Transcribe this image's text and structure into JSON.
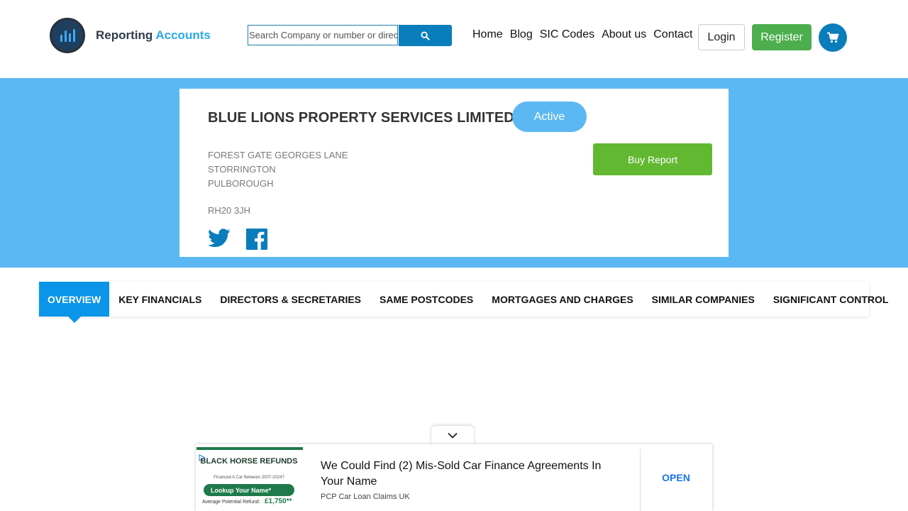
{
  "header": {
    "logo": {
      "text_primary": "Reporting",
      "text_accent": "Accounts"
    },
    "search": {
      "placeholder": "Search Company or number or director"
    },
    "nav": [
      {
        "label": "Home"
      },
      {
        "label": "Blog"
      },
      {
        "label": "SIC Codes"
      },
      {
        "label": "About us"
      },
      {
        "label": "Contact"
      }
    ],
    "login_label": "Login",
    "register_label": "Register"
  },
  "company": {
    "name": "BLUE LIONS PROPERTY SERVICES LIMITED",
    "status": "Active",
    "address_lines": [
      "FOREST GATE GEORGES LANE",
      "STORRINGTON",
      "PULBOROUGH"
    ],
    "postcode": "RH20 3JH",
    "buy_label": "Buy Report"
  },
  "tabs": [
    {
      "label": "OVERVIEW",
      "active": true
    },
    {
      "label": "KEY FINANCIALS"
    },
    {
      "label": "DIRECTORS & SECRETARIES"
    },
    {
      "label": "SAME POSTCODES"
    },
    {
      "label": "MORTGAGES AND CHARGES"
    },
    {
      "label": "SIMILAR COMPANIES"
    },
    {
      "label": "SIGNIFICANT CONTROL"
    }
  ],
  "ad": {
    "image": {
      "brand": "BLACK HORSE REFUNDS",
      "subtitle": "Financed A Car Between 2007-2024?",
      "cta": "Lookup Your Name*",
      "refund_label": "Average Potential Refund:",
      "refund_amount": "£1,750**"
    },
    "headline": "We Could Find (2) Mis-Sold Car Finance Agreements In Your Name",
    "source": "PCP Car Loan Claims UK",
    "open_label": "OPEN"
  },
  "colors": {
    "hero_bg": "#5cb8f2",
    "primary_blue": "#0a7dbb",
    "tab_active": "#0a95e9",
    "register_green": "#4cae4c",
    "buy_green": "#63b832"
  }
}
